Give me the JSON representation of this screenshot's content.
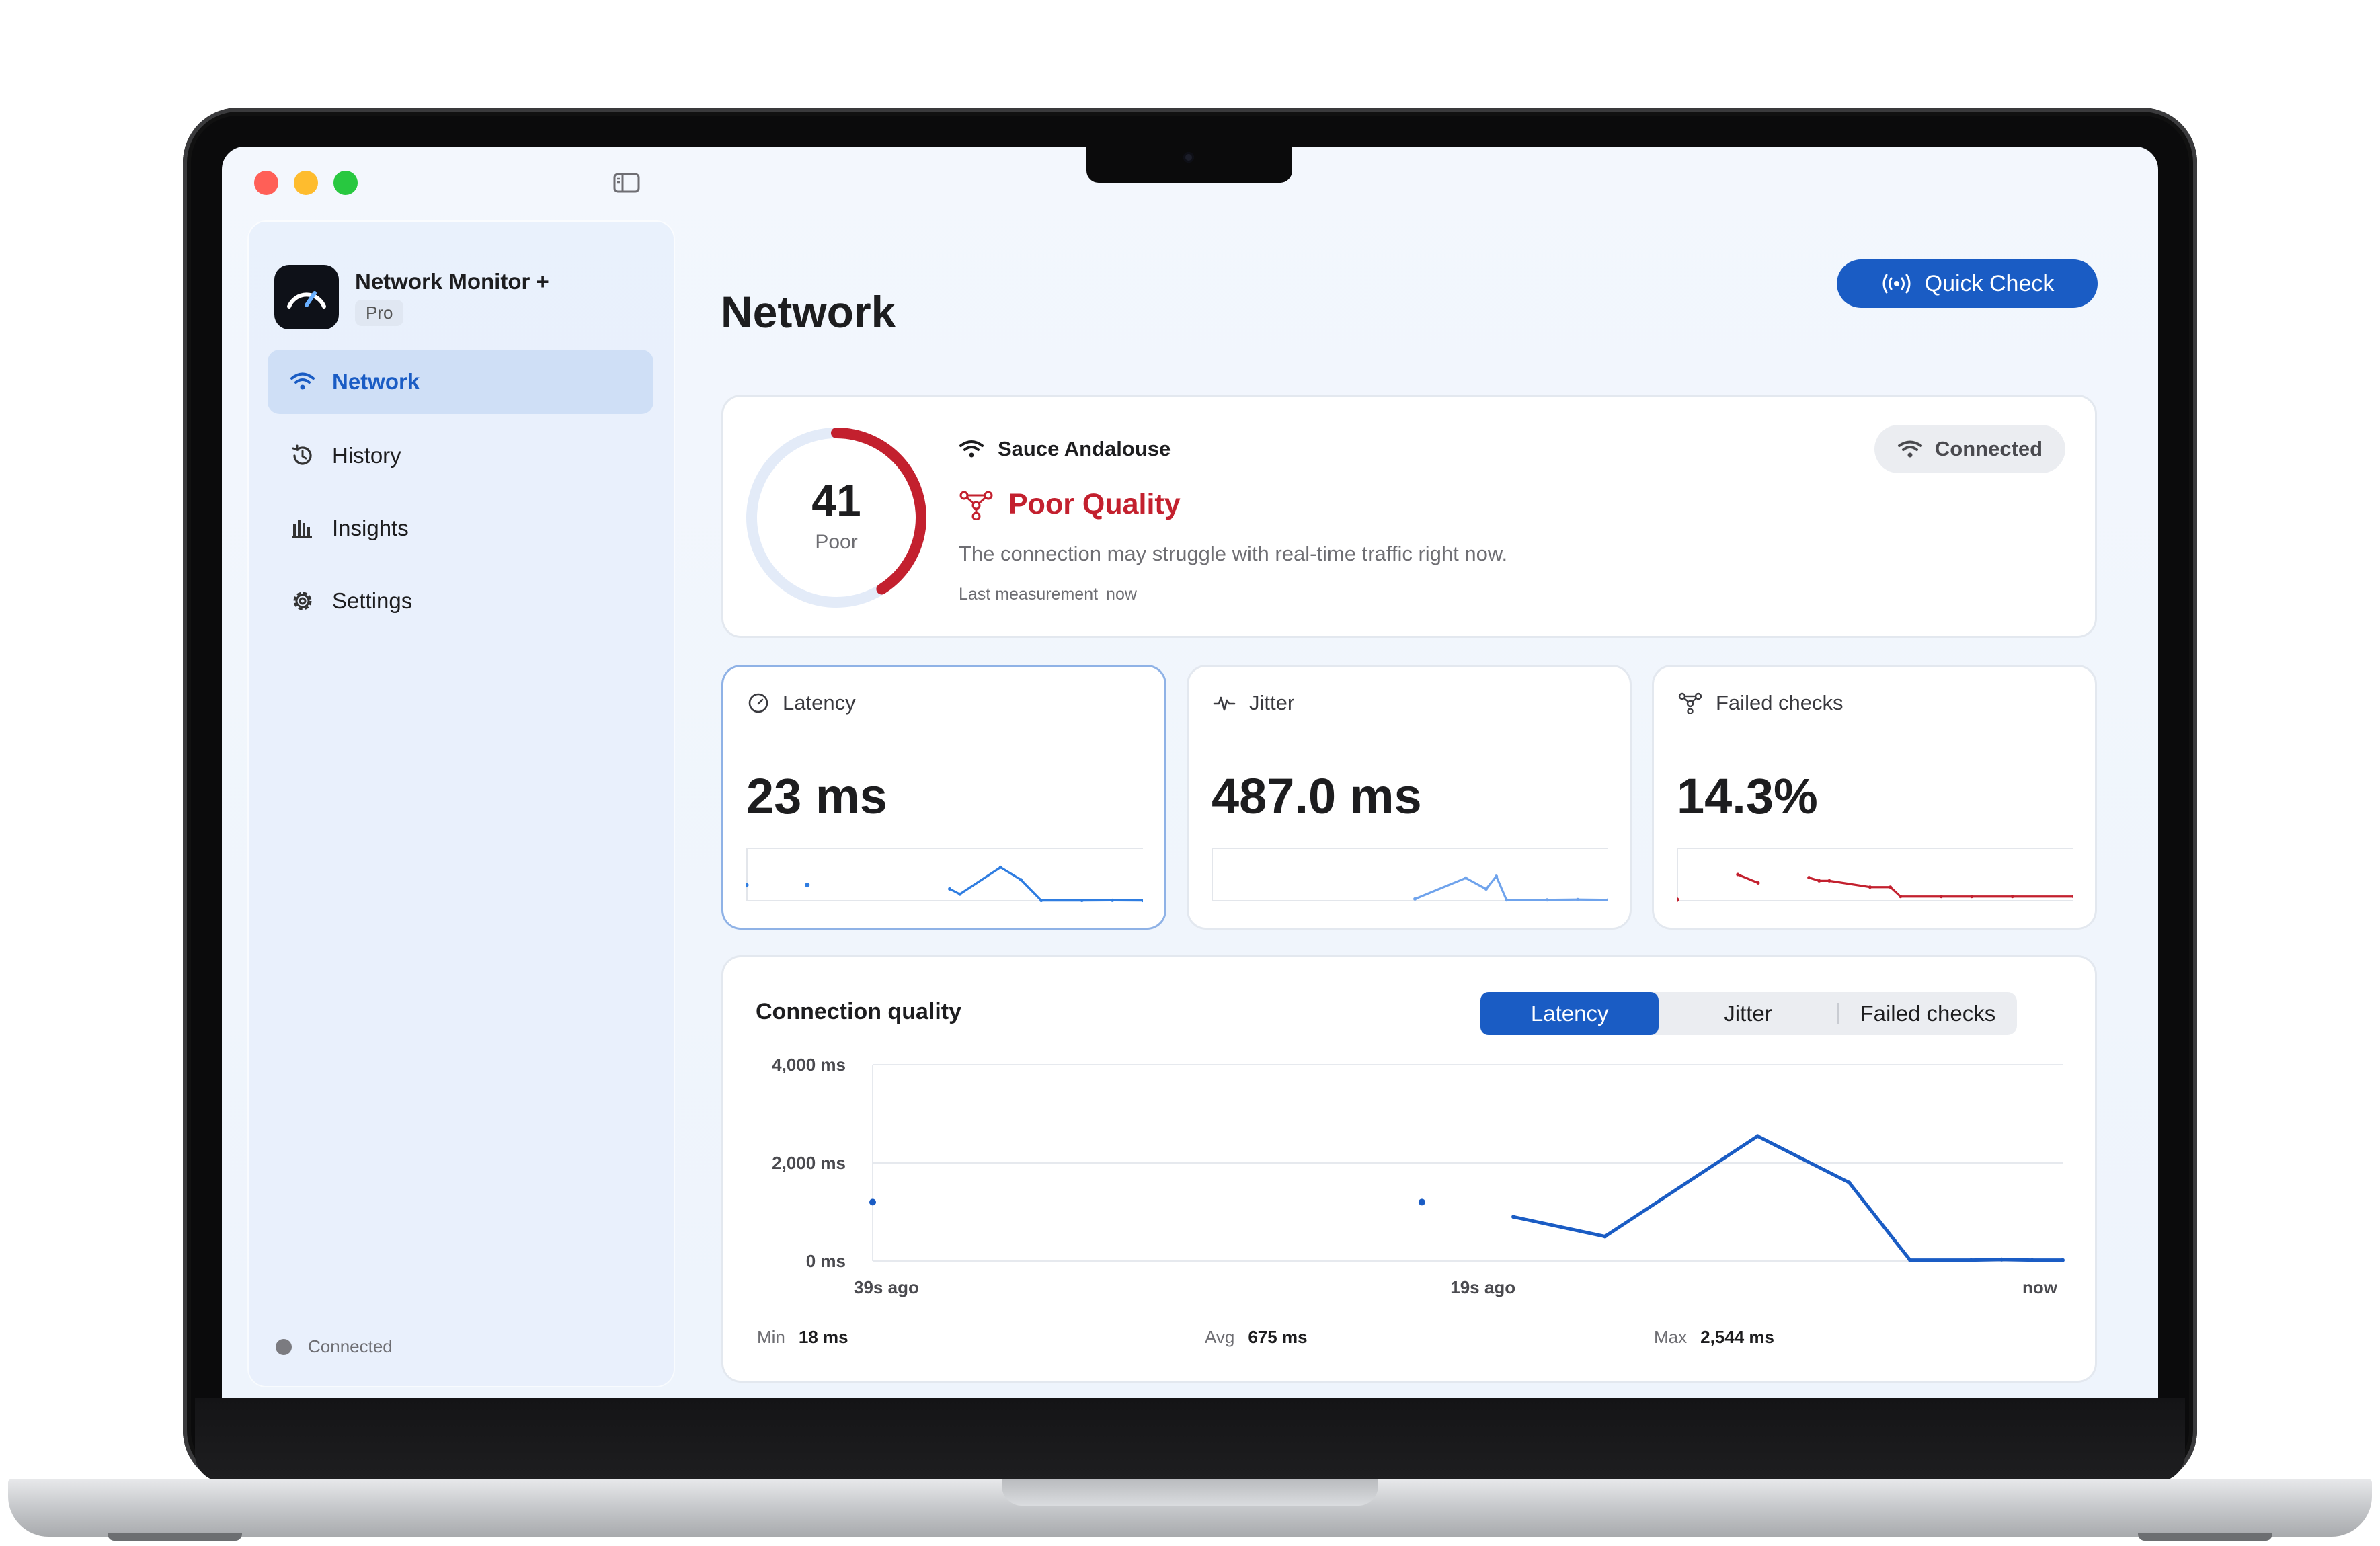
{
  "app": {
    "name": "Network Monitor +",
    "badge": "Pro"
  },
  "sidebar": {
    "items": [
      {
        "label": "Network",
        "icon": "wifi-icon",
        "active": true
      },
      {
        "label": "History",
        "icon": "history-icon",
        "active": false
      },
      {
        "label": "Insights",
        "icon": "chart-bars-icon",
        "active": false
      },
      {
        "label": "Settings",
        "icon": "gear-icon",
        "active": false
      }
    ],
    "status": "Connected"
  },
  "header": {
    "title": "Network",
    "quick_check_label": "Quick Check"
  },
  "summary": {
    "score": "41",
    "score_label": "Poor",
    "score_fraction": 0.41,
    "network_name": "Sauce Andalouse",
    "quality": "Poor Quality",
    "description": "The connection may struggle with real-time traffic right now.",
    "last_measurement_label": "Last measurement",
    "last_measurement_value": "now",
    "connection_status": "Connected"
  },
  "metrics": [
    {
      "label": "Latency",
      "value": "23 ms",
      "icon": "speedometer-icon",
      "color": "#2f7de1",
      "selected": true
    },
    {
      "label": "Jitter",
      "value": "487.0 ms",
      "icon": "waveform-icon",
      "color": "#6fa3ec",
      "selected": false
    },
    {
      "label": "Failed checks",
      "value": "14.3%",
      "icon": "network-nodes-icon",
      "color": "#c3202e",
      "selected": false
    }
  ],
  "connection_quality": {
    "title": "Connection quality",
    "tabs": [
      "Latency",
      "Jitter",
      "Failed checks"
    ],
    "active_tab": "Latency",
    "stats": {
      "min_label": "Min",
      "min_value": "18 ms",
      "avg_label": "Avg",
      "avg_value": "675 ms",
      "max_label": "Max",
      "max_value": "2,544 ms"
    }
  },
  "colors": {
    "accent": "#1a5cc4",
    "poor": "#c3202e"
  },
  "chart_data": {
    "type": "line",
    "x": [
      -39,
      -38,
      -20,
      -19,
      -17,
      -15,
      -13,
      -12,
      -10,
      -8,
      -6,
      -4,
      -2,
      0
    ],
    "values": [
      1200,
      null,
      1200,
      null,
      900,
      500,
      2544,
      1600,
      18,
      18,
      30,
      18,
      18,
      18
    ],
    "point_series": [
      {
        "x": -39,
        "y": 1200
      },
      {
        "x": -21,
        "y": 1200
      }
    ],
    "line_series": [
      {
        "x": -18,
        "y": 900
      },
      {
        "x": -15,
        "y": 500
      },
      {
        "x": -10,
        "y": 2544
      },
      {
        "x": -7,
        "y": 1600
      },
      {
        "x": -5,
        "y": 18
      },
      {
        "x": -3,
        "y": 18
      },
      {
        "x": -2,
        "y": 30
      },
      {
        "x": -1,
        "y": 18
      },
      {
        "x": 0,
        "y": 18
      }
    ],
    "yticks": [
      "4,000 ms",
      "2,000 ms",
      "0 ms"
    ],
    "ytick_values": [
      4000,
      2000,
      0
    ],
    "xticks": [
      "39s ago",
      "19s ago",
      "now"
    ],
    "xtick_values": [
      -39,
      -19,
      0
    ],
    "xlim": [
      -39,
      0
    ],
    "ylim": [
      0,
      4000
    ],
    "grid": true,
    "color": "#1a5cc4"
  },
  "sparklines": {
    "latency": {
      "points": [
        [
          -39,
          1200
        ],
        [
          -33,
          1200
        ],
        [
          -19,
          900
        ],
        [
          -18,
          500
        ],
        [
          -14,
          2544
        ],
        [
          -12,
          1600
        ],
        [
          -10,
          18
        ],
        [
          -6,
          18
        ],
        [
          -3,
          30
        ],
        [
          0,
          18
        ]
      ],
      "segments": [
        [
          0
        ],
        [
          1
        ],
        [
          2,
          3,
          4,
          5,
          6,
          7,
          8,
          9
        ]
      ],
      "ymax": 4000
    },
    "jitter": {
      "points": [
        [
          -19,
          60
        ],
        [
          -14,
          780
        ],
        [
          -12,
          400
        ],
        [
          -11,
          840
        ],
        [
          -10,
          30
        ],
        [
          -6,
          30
        ],
        [
          -3,
          40
        ],
        [
          0,
          30
        ]
      ],
      "segments": [
        [
          0,
          1,
          2,
          3,
          4,
          5,
          6,
          7
        ]
      ],
      "ymax": 1800
    },
    "failed": {
      "points": [
        [
          -39,
          2
        ],
        [
          -33,
          50
        ],
        [
          -31,
          34
        ],
        [
          -26,
          44
        ],
        [
          -25,
          38
        ],
        [
          -24,
          38
        ],
        [
          -20,
          26
        ],
        [
          -18,
          26
        ],
        [
          -17,
          8
        ],
        [
          -13,
          8
        ],
        [
          -10,
          8
        ],
        [
          -6,
          8
        ],
        [
          0,
          8
        ]
      ],
      "segments": [
        [
          0
        ],
        [
          1,
          2
        ],
        [
          3,
          4,
          5,
          6,
          7,
          8,
          9,
          10,
          11,
          12
        ]
      ],
      "ymax": 100
    }
  }
}
